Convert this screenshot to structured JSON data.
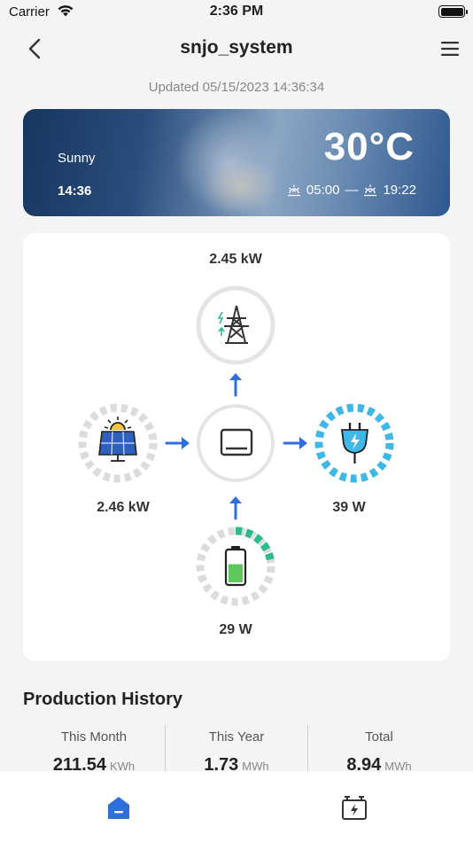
{
  "status_bar": {
    "carrier": "Carrier",
    "time": "2:36 PM"
  },
  "nav": {
    "title": "snjo_system"
  },
  "updated": "Updated 05/15/2023 14:36:34",
  "weather": {
    "condition": "Sunny",
    "time": "14:36",
    "temperature": "30°C",
    "sunrise": "05:00",
    "separator": "—",
    "sunset": "19:22"
  },
  "energy_flow": {
    "grid_power": "2.45 kW",
    "solar_power": "2.46 kW",
    "load_power": "39 W",
    "battery_power": "29 W",
    "battery_level": 0.25
  },
  "production_history": {
    "title": "Production History",
    "columns": [
      {
        "label": "This Month",
        "value": "211.54",
        "unit": "KWh"
      },
      {
        "label": "This Year",
        "value": "1.73",
        "unit": "MWh"
      },
      {
        "label": "Total",
        "value": "8.94",
        "unit": "MWh"
      }
    ]
  },
  "colors": {
    "accent": "#2f6fdc",
    "load": "#3fb8e6",
    "battery": "#2dbb8a",
    "ring": "#e4e4e4",
    "arrow": "#2f6fdc"
  },
  "icons": {
    "back": "chevron-left-icon",
    "menu": "hamburger-icon",
    "grid": "power-tower-icon",
    "solar": "solar-panel-icon",
    "inverter": "inverter-icon",
    "load": "plug-icon",
    "battery": "battery-icon",
    "home_tab": "home-icon",
    "device_tab": "battery-device-icon"
  }
}
